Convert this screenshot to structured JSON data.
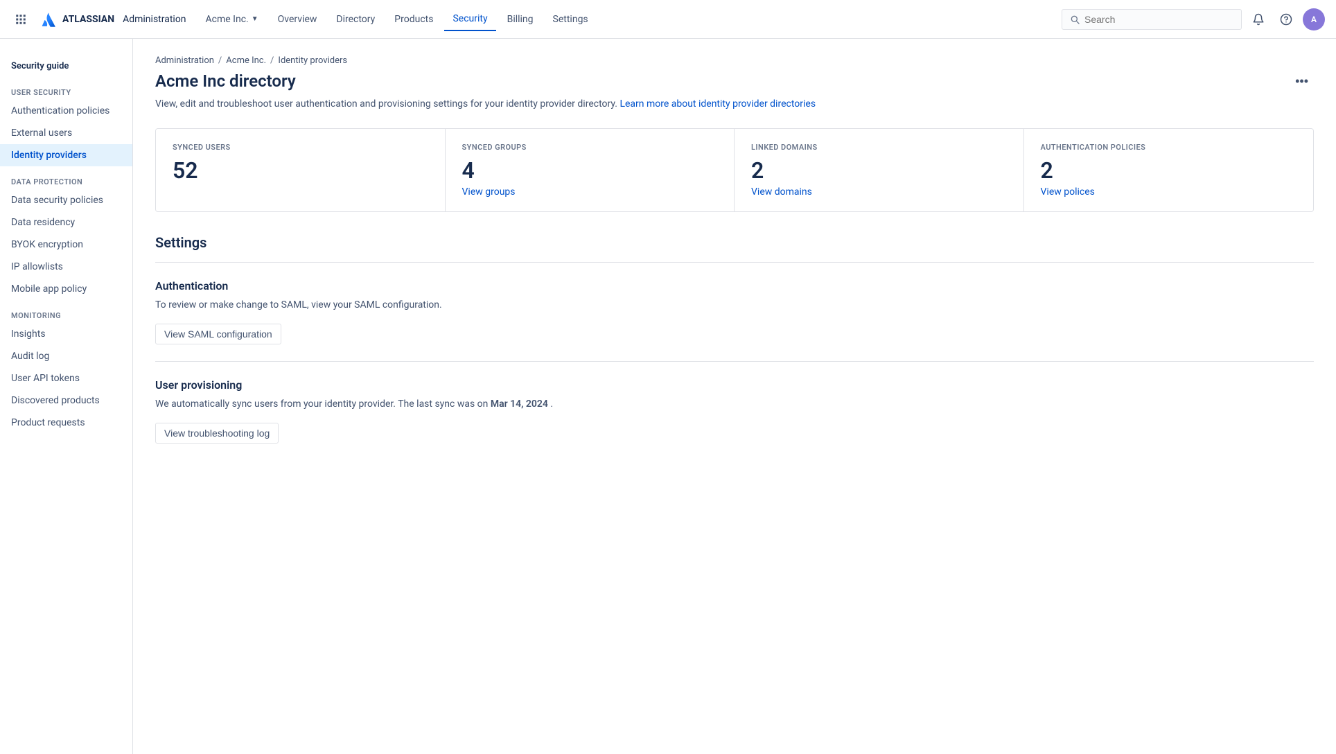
{
  "topnav": {
    "app_name": "Administration",
    "org_name": "Acme Inc.",
    "search_placeholder": "Search",
    "nav_items": [
      {
        "label": "Overview",
        "active": false
      },
      {
        "label": "Directory",
        "active": false
      },
      {
        "label": "Products",
        "active": false
      },
      {
        "label": "Security",
        "active": true
      },
      {
        "label": "Billing",
        "active": false
      },
      {
        "label": "Settings",
        "active": false
      }
    ]
  },
  "sidebar": {
    "title": "Security guide",
    "sections": [
      {
        "label": "USER SECURITY",
        "items": [
          {
            "label": "Authentication policies",
            "active": false
          },
          {
            "label": "External users",
            "active": false
          },
          {
            "label": "Identity providers",
            "active": true
          }
        ]
      },
      {
        "label": "DATA PROTECTION",
        "items": [
          {
            "label": "Data security policies",
            "active": false
          },
          {
            "label": "Data residency",
            "active": false
          },
          {
            "label": "BYOK encryption",
            "active": false
          },
          {
            "label": "IP allowlists",
            "active": false
          },
          {
            "label": "Mobile app policy",
            "active": false
          }
        ]
      },
      {
        "label": "MONITORING",
        "items": [
          {
            "label": "Insights",
            "active": false
          },
          {
            "label": "Audit log",
            "active": false
          },
          {
            "label": "User API tokens",
            "active": false
          },
          {
            "label": "Discovered products",
            "active": false
          },
          {
            "label": "Product requests",
            "active": false
          }
        ]
      }
    ]
  },
  "breadcrumb": {
    "items": [
      {
        "label": "Administration"
      },
      {
        "label": "Acme Inc."
      },
      {
        "label": "Identity providers"
      }
    ]
  },
  "page": {
    "title": "Acme Inc directory",
    "description": "View, edit and troubleshoot user authentication and provisioning settings for your identity provider directory.",
    "learn_more_text": "Learn more about identity provider directories",
    "stats": [
      {
        "label": "SYNCED USERS",
        "value": "52",
        "link": null
      },
      {
        "label": "SYNCED GROUPS",
        "value": "4",
        "link": "View groups"
      },
      {
        "label": "LINKED DOMAINS",
        "value": "2",
        "link": "View domains"
      },
      {
        "label": "AUTHENTICATION POLICIES",
        "value": "2",
        "link": "View polices"
      }
    ],
    "settings_title": "Settings",
    "sections": [
      {
        "id": "authentication",
        "title": "Authentication",
        "description": "To review or make change to SAML, view your SAML configuration.",
        "button_label": "View SAML configuration"
      },
      {
        "id": "user_provisioning",
        "title": "User provisioning",
        "description_prefix": "We automatically sync users from your identity provider. The last sync was on",
        "last_sync": "Mar 14, 2024",
        "description_suffix": ".",
        "button_label": "View troubleshooting log"
      }
    ]
  }
}
